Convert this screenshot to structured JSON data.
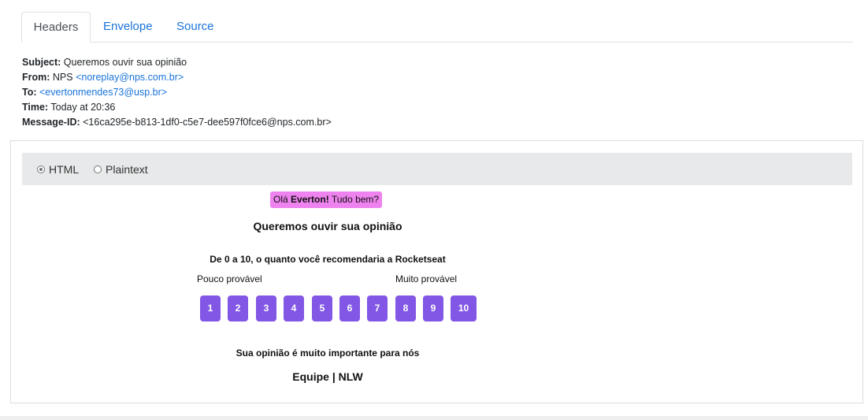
{
  "tabs": [
    {
      "label": "Headers",
      "active": true
    },
    {
      "label": "Envelope",
      "active": false
    },
    {
      "label": "Source",
      "active": false
    }
  ],
  "headers": {
    "subject_label": "Subject:",
    "subject": "Queremos ouvir sua opinião",
    "from_label": "From:",
    "from_name": "NPS",
    "from_email": "<noreplay@nps.com.br>",
    "to_label": "To:",
    "to_email": "<evertonmendes73@usp.br>",
    "time_label": "Time:",
    "time": "Today at 20:36",
    "message_id_label": "Message-ID:",
    "message_id": "<16ca295e-b813-1df0-c5e7-dee597f0fce6@nps.com.br>"
  },
  "format": {
    "options": [
      {
        "label": "HTML",
        "checked": true
      },
      {
        "label": "Plaintext",
        "checked": false
      }
    ]
  },
  "email": {
    "greeting_prefix": "Olá",
    "greeting_name": "Everton!",
    "greeting_suffix": "Tudo bem?",
    "title": "Queremos ouvir sua opinião",
    "question": "De 0 a 10, o quanto você recomendaria a Rocketseat",
    "low_label": "Pouco provável",
    "high_label": "Muito provável",
    "scores": [
      "1",
      "2",
      "3",
      "4",
      "5",
      "6",
      "7",
      "8",
      "9",
      "10"
    ],
    "footer_note": "Sua opinião é muito importante para nós",
    "signature": "Equipe | NLW"
  },
  "colors": {
    "accent_link": "#1a73d9",
    "score_button": "#8257e5",
    "greeting_bg": "#ee82ee",
    "format_bar_bg": "#e8e9ea"
  }
}
